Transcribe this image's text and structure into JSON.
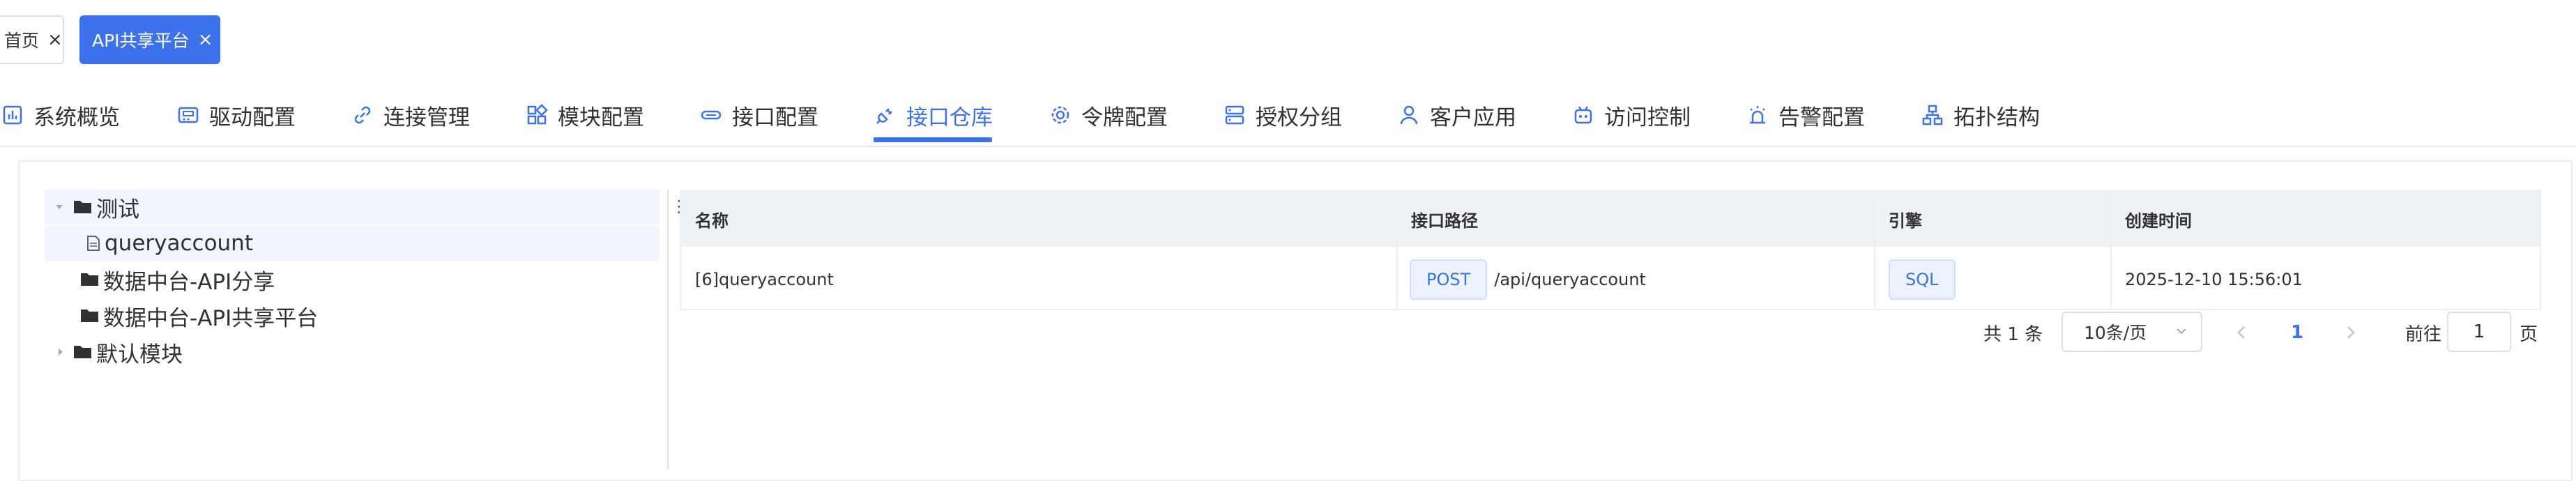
{
  "tags": [
    {
      "label": "首页",
      "close": "×"
    },
    {
      "label": "API共享平台",
      "close": "×"
    }
  ],
  "nav": [
    {
      "label": "系统概览",
      "icon": "chart-icon"
    },
    {
      "label": "驱动配置",
      "icon": "driver-icon"
    },
    {
      "label": "连接管理",
      "icon": "link-icon"
    },
    {
      "label": "模块配置",
      "icon": "grid-icon"
    },
    {
      "label": "接口配置",
      "icon": "api-icon"
    },
    {
      "label": "接口仓库",
      "icon": "plug-icon"
    },
    {
      "label": "令牌配置",
      "icon": "gear-icon"
    },
    {
      "label": "授权分组",
      "icon": "server-icon"
    },
    {
      "label": "客户应用",
      "icon": "user-icon"
    },
    {
      "label": "访问控制",
      "icon": "robot-icon"
    },
    {
      "label": "告警配置",
      "icon": "alarm-icon"
    },
    {
      "label": "拓扑结构",
      "icon": "topology-icon"
    }
  ],
  "active_tab": "接口仓库",
  "accent": "#3b72ec",
  "tree": [
    {
      "label": "测试",
      "expanded": true
    },
    {
      "label": "queryaccount"
    },
    {
      "label": "数据中台-API分享"
    },
    {
      "label": "数据中台-API共享平台"
    },
    {
      "label": "默认模块",
      "expanded": false
    }
  ],
  "table": {
    "headers": [
      "名称",
      "接口路径",
      "引擎",
      "创建时间"
    ],
    "rows": [
      {
        "name": "[6]queryaccount",
        "method": "POST",
        "path": "/api/queryaccount",
        "engine": "SQL",
        "created": "2025-12-10 15:56:01"
      }
    ]
  },
  "pagination": {
    "total": "共 1 条",
    "page_size": "10条/页",
    "current_page": "1",
    "goto_label": "前往",
    "goto_value": "1",
    "page_suffix": "页"
  }
}
